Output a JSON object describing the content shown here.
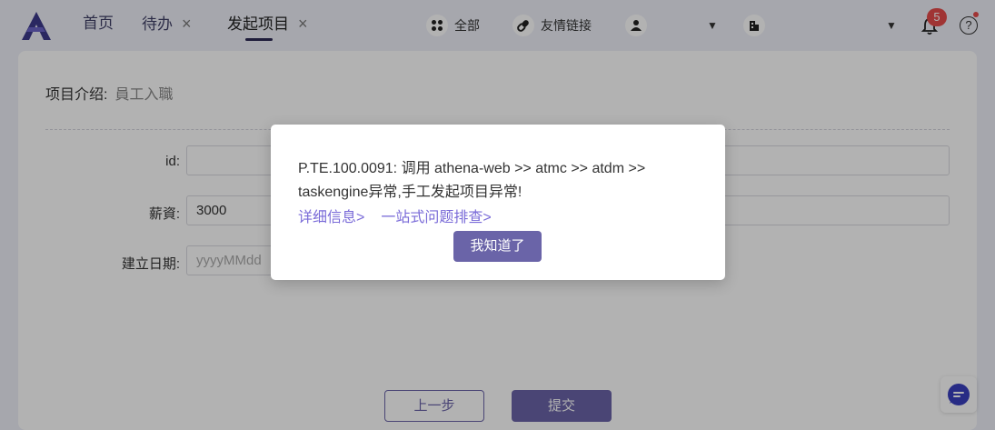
{
  "nav": {
    "tabs": [
      {
        "label": "首页"
      },
      {
        "label": "待办",
        "close": "×"
      },
      {
        "label": "发起项目",
        "close": "×"
      }
    ],
    "all_label": "全部",
    "links_label": "友情链接",
    "dropdown_arrow": "▼",
    "notification_count": "5",
    "help_glyph": "?"
  },
  "form": {
    "intro_label": "项目介绍:",
    "intro_value": "員工入職",
    "fields": [
      {
        "label": "id:",
        "value": ""
      },
      {
        "label": "薪資:",
        "value": "3000"
      },
      {
        "label": "建立日期:",
        "placeholder": "yyyyMMdd"
      }
    ],
    "prev_label": "上一步",
    "submit_label": "提交"
  },
  "modal": {
    "message": "P.TE.100.0091: 调用 athena-web >> atmc >> atdm >> taskengine异常,手工发起项目异常!",
    "detail_link": "详细信息>",
    "troubleshoot_link": "一站式问题排查>",
    "ok_label": "我知道了"
  },
  "colors": {
    "accent": "#6a64a8",
    "link": "#7a6bd8",
    "badge": "#e54b4b"
  },
  "icons": [
    "logo-icon",
    "grid-icon",
    "link-icon",
    "user-icon",
    "company-icon",
    "bell-icon",
    "help-icon",
    "chat-icon"
  ]
}
